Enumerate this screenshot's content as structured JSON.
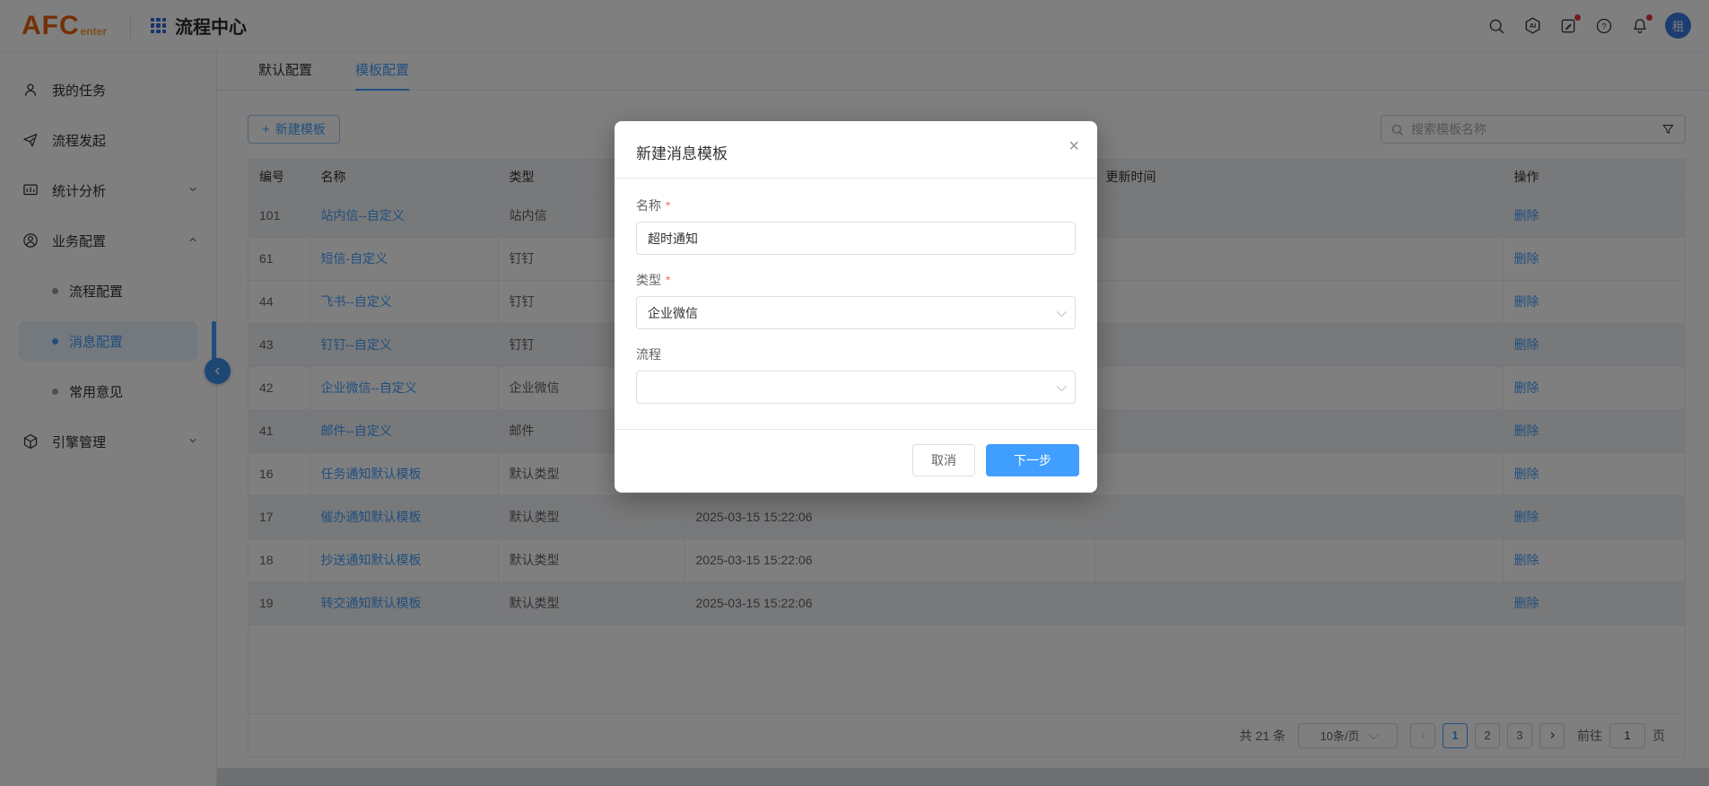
{
  "header": {
    "logo_main": "AFC",
    "logo_sub": "enter",
    "app_title": "流程中心",
    "ai_icon_label": "AI",
    "help_icon_label": "?",
    "avatar_label": "租"
  },
  "sidebar": {
    "my_tasks": "我的任务",
    "process_start": "流程发起",
    "stats_analysis": "统计分析",
    "business_config": "业务配置",
    "process_config": "流程配置",
    "message_config": "消息配置",
    "common_opinions": "常用意见",
    "engine_manage": "引擎管理"
  },
  "tabs": {
    "default_config": "默认配置",
    "template_config": "模板配置"
  },
  "toolbar": {
    "new_template_button": "新建模板",
    "plus_icon": "+",
    "search_placeholder": "搜索模板名称"
  },
  "table": {
    "headers": {
      "id": "编号",
      "name": "名称",
      "type": "类型",
      "hidden": "",
      "updated": "更新时间",
      "actions": "操作"
    },
    "delete_label": "删除",
    "rows": [
      {
        "id": "101",
        "name": "站内信--自定义",
        "type": "站内信",
        "date": "",
        "updated": "",
        "striped": true
      },
      {
        "id": "61",
        "name": "短信-自定义",
        "type": "钉钉",
        "date": "",
        "updated": "",
        "striped": false
      },
      {
        "id": "44",
        "name": "飞书--自定义",
        "type": "钉钉",
        "date": "",
        "updated": "",
        "striped": false
      },
      {
        "id": "43",
        "name": "钉钉--自定义",
        "type": "钉钉",
        "date": "",
        "updated": "",
        "striped": true
      },
      {
        "id": "42",
        "name": "企业微信--自定义",
        "type": "企业微信",
        "date": "",
        "updated": "",
        "striped": false
      },
      {
        "id": "41",
        "name": "邮件--自定义",
        "type": "邮件",
        "date": "",
        "updated": "",
        "striped": true
      },
      {
        "id": "16",
        "name": "任务通知默认模板",
        "type": "默认类型",
        "date": "",
        "updated": "",
        "striped": false
      },
      {
        "id": "17",
        "name": "催办通知默认模板",
        "type": "默认类型",
        "date": "2025-03-15 15:22:06",
        "updated": "",
        "striped": true
      },
      {
        "id": "18",
        "name": "抄送通知默认模板",
        "type": "默认类型",
        "date": "2025-03-15 15:22:06",
        "updated": "",
        "striped": false
      },
      {
        "id": "19",
        "name": "转交通知默认模板",
        "type": "默认类型",
        "date": "2025-03-15 15:22:06",
        "updated": "",
        "striped": true
      }
    ]
  },
  "pagination": {
    "total_text": "共 21 条",
    "page_size": "10条/页",
    "pages": [
      {
        "label": "1",
        "active": true
      },
      {
        "label": "2",
        "active": false
      },
      {
        "label": "3",
        "active": false
      }
    ],
    "goto_label": "前往",
    "goto_value": "1",
    "page_unit": "页"
  },
  "modal": {
    "title": "新建消息模板",
    "close_icon": "×",
    "name_label": "名称",
    "name_value": "超时通知",
    "type_label": "类型",
    "type_value": "企业微信",
    "process_label": "流程",
    "process_value": "",
    "required_mark": "*",
    "cancel_button": "取消",
    "next_button": "下一步"
  },
  "colors": {
    "accent": "#409EFF",
    "logo_orange": "#E8610C",
    "logo_sub_orange": "#F2A33C",
    "danger_red": "#F56C6C",
    "avatar_blue": "#3A7BE0"
  }
}
